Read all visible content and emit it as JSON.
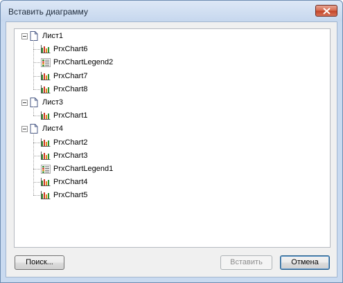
{
  "window": {
    "title": "Вставить диаграмму"
  },
  "tree": {
    "sheets": [
      {
        "label": "Лист1",
        "children": [
          {
            "label": "PrxChart6",
            "icon": "chart-icon"
          },
          {
            "label": "PrxChartLegend2",
            "icon": "legend-icon"
          },
          {
            "label": "PrxChart7",
            "icon": "chart-icon"
          },
          {
            "label": "PrxChart8",
            "icon": "chart-icon"
          }
        ]
      },
      {
        "label": "Лист3",
        "children": [
          {
            "label": "PrxChart1",
            "icon": "chart-icon"
          }
        ]
      },
      {
        "label": "Лист4",
        "children": [
          {
            "label": "PrxChart2",
            "icon": "chart-icon"
          },
          {
            "label": "PrxChart3",
            "icon": "chart-icon"
          },
          {
            "label": "PrxChartLegend1",
            "icon": "legend-icon"
          },
          {
            "label": "PrxChart4",
            "icon": "chart-icon"
          },
          {
            "label": "PrxChart5",
            "icon": "chart-icon"
          }
        ]
      }
    ]
  },
  "buttons": {
    "search": "Поиск...",
    "insert": "Вставить",
    "cancel": "Отмена"
  },
  "colors": {
    "bar_green": "#2f8f2f",
    "bar_red": "#cc3322",
    "bar_orange": "#e28b1a"
  }
}
